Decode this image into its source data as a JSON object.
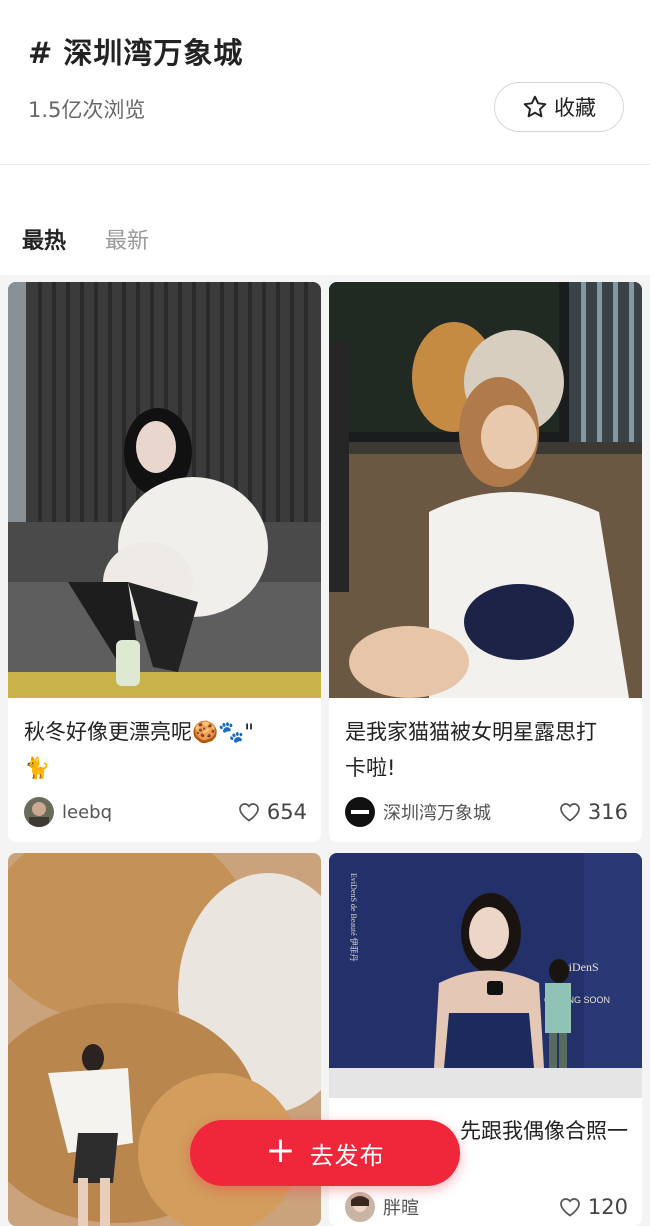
{
  "header": {
    "hash": "#",
    "title": "深圳湾万象城",
    "views": "1.5亿次浏览",
    "favorite_label": "收藏"
  },
  "tabs": [
    {
      "label": "最热",
      "active": true
    },
    {
      "label": "最新",
      "active": false
    }
  ],
  "posts": [
    {
      "caption_line1": "秋冬好像更漂亮呢🍪🐾\"",
      "caption_line2": "🐈",
      "author": "leebq",
      "likes": "654"
    },
    {
      "caption_line1": "是我家猫猫被女明星露思打",
      "caption_line2": "卡啦!",
      "author": "深圳湾万象城",
      "likes": "316"
    },
    {
      "caption_line1": "",
      "author": "",
      "likes": ""
    },
    {
      "caption_line1": "先跟我偶像合照一",
      "author": "胖暄",
      "likes": "120"
    }
  ],
  "poster_text": {
    "brand": "EviDenS",
    "coming_soon": "COMING SOON",
    "side_text": "EviDenS de Beauté 伊菲丹"
  },
  "publish_button": {
    "label": "去发布"
  },
  "colors": {
    "accent": "#f0263b"
  }
}
